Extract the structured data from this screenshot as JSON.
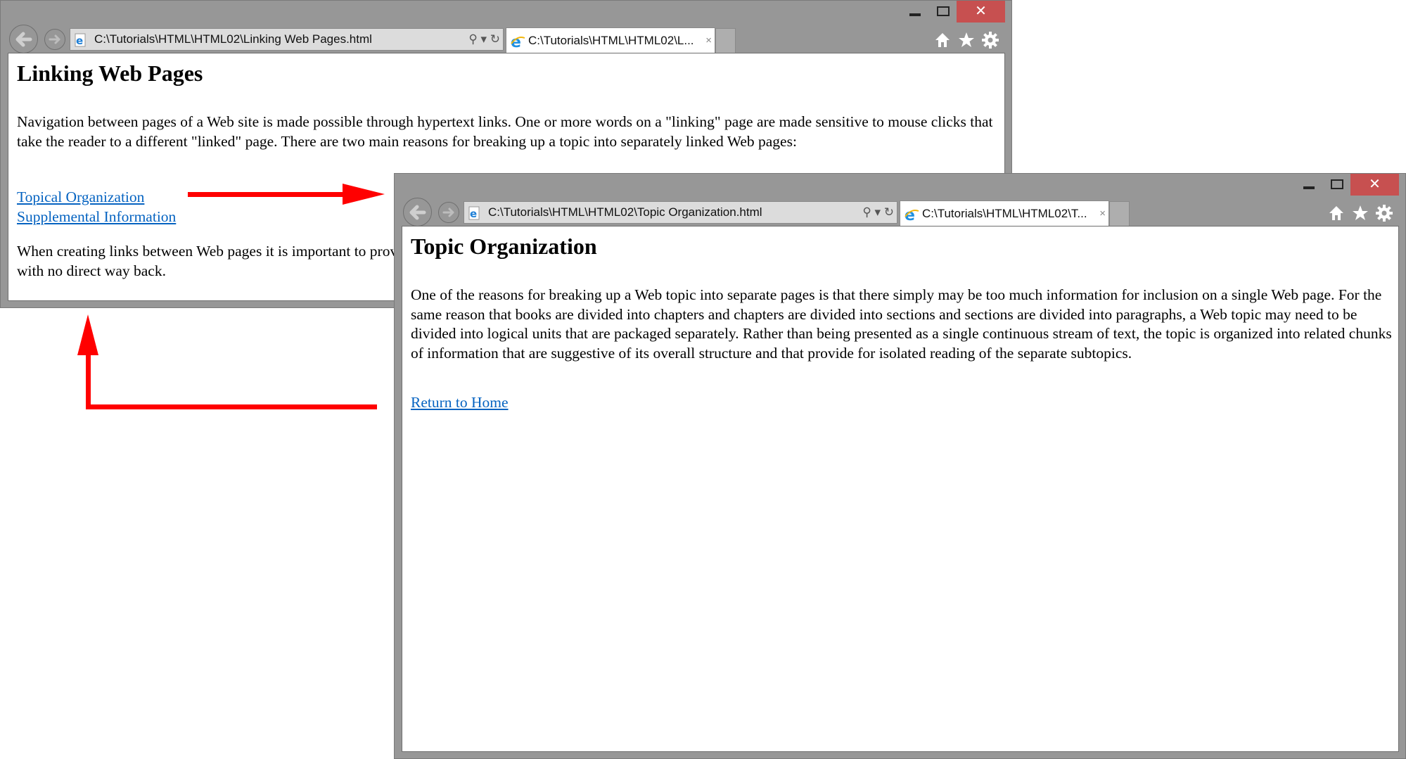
{
  "colors": {
    "chrome": "#979797",
    "close_button": "#c75050",
    "link": "#0563c1",
    "annotation_arrow": "#ff0000"
  },
  "windows": [
    {
      "id": "linking-web-pages",
      "caption": {
        "minimize_icon": "minimize-icon",
        "maximize_icon": "maximize-icon",
        "close_label": "✕"
      },
      "address_bar": {
        "url": "C:\\Tutorials\\HTML\\HTML02\\Linking Web Pages.html",
        "tools": "⚲ ▾ ↻"
      },
      "tab": {
        "title": "C:\\Tutorials\\HTML\\HTML02\\L...",
        "close": "×"
      },
      "toolbar_icons": [
        "home-icon",
        "favorites-star-icon",
        "settings-gear-icon"
      ],
      "page": {
        "heading": "Linking Web Pages",
        "intro": "Navigation between pages of a Web site is made possible through hypertext links. One or more words on a \"linking\" page are made sensitive to mouse clicks that take the reader to a different \"linked\" page. There are two main reasons for breaking up a topic into separately linked Web pages:",
        "links": [
          "Topical Organization",
          "Supplemental Information"
        ],
        "closing": "When creating links between Web pages it is important to provide a way to return to the original page so users are not left dangling at the end of a series of links with no direct way back."
      }
    },
    {
      "id": "topic-organization",
      "caption": {
        "minimize_icon": "minimize-icon",
        "maximize_icon": "maximize-icon",
        "close_label": "✕"
      },
      "address_bar": {
        "url": "C:\\Tutorials\\HTML\\HTML02\\Topic Organization.html",
        "tools": "⚲ ▾ ↻"
      },
      "tab": {
        "title": "C:\\Tutorials\\HTML\\HTML02\\T...",
        "close": "×"
      },
      "toolbar_icons": [
        "home-icon",
        "favorites-star-icon",
        "settings-gear-icon"
      ],
      "page": {
        "heading": "Topic Organization",
        "body": "One of the reasons for breaking up a Web topic into separate pages is that there simply may be too much information for inclusion on a single Web page. For the same reason that books are divided into chapters and chapters are divided into sections and sections are divided into paragraphs, a Web topic may need to be divided into logical units that are packaged separately. Rather than being presented as a single continuous stream of text, the topic is organized into related chunks of information that are suggestive of its overall structure and that provide for isolated reading of the separate subtopics.",
        "return_link": "Return to Home"
      }
    }
  ],
  "annotations": [
    {
      "name": "arrow-to-topic-organization",
      "direction": "right"
    },
    {
      "name": "arrow-return-to-home",
      "direction": "up"
    }
  ]
}
